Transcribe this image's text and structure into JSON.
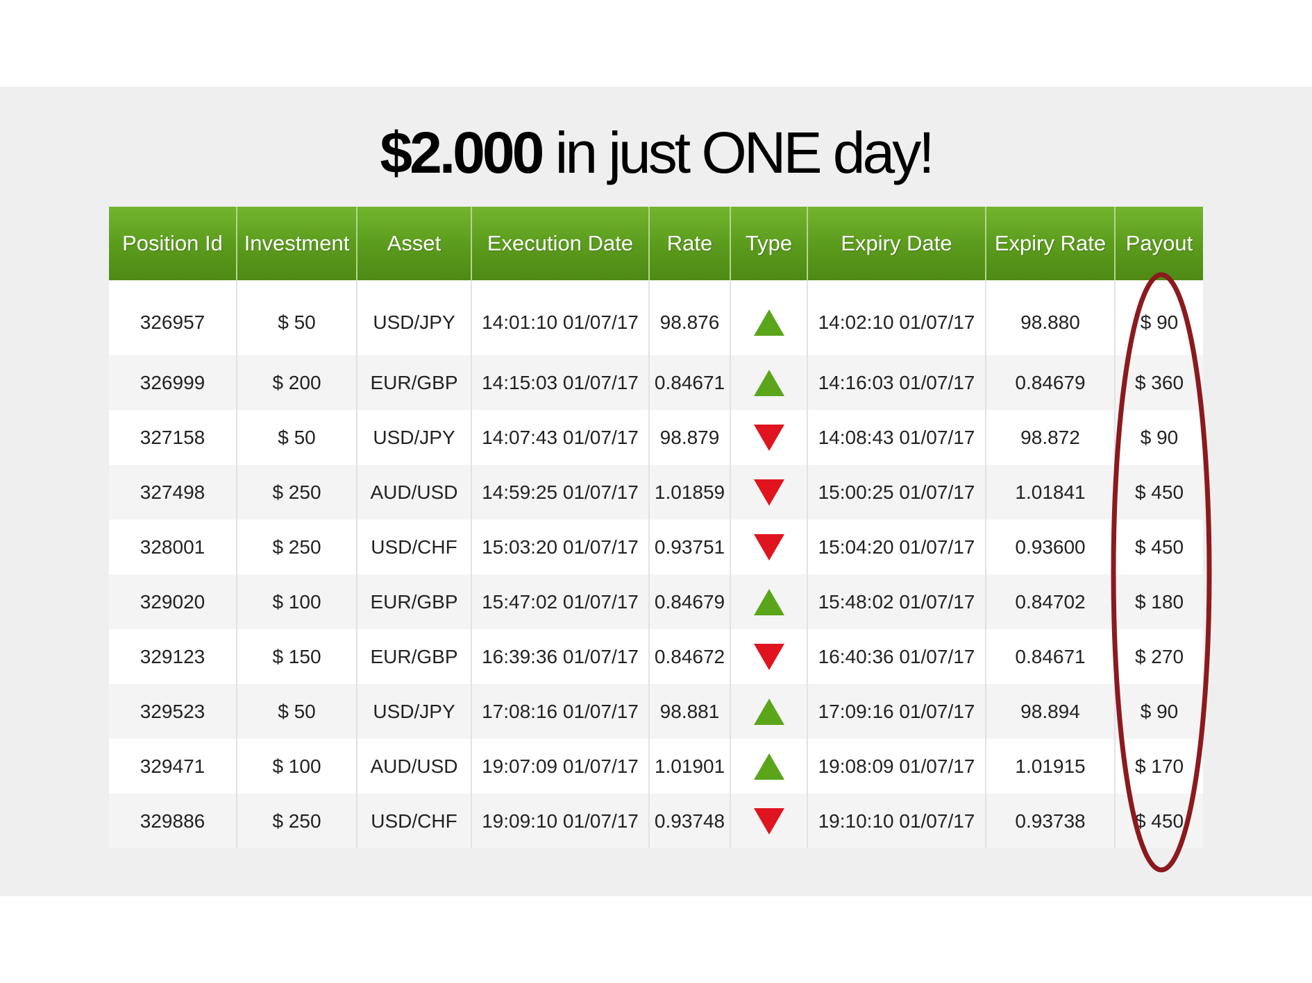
{
  "headline": {
    "amount": "$2.000",
    "rest": " in just ONE day!"
  },
  "table": {
    "headers": [
      "Position Id",
      "Investment",
      "Asset",
      "Execution Date",
      "Rate",
      "Type",
      "Expiry Date",
      "Expiry Rate",
      "Payout"
    ],
    "rows": [
      {
        "position_id": "326957",
        "investment": "$ 50",
        "asset": "USD/JPY",
        "execution_date": "14:01:10 01/07/17",
        "rate": "98.876",
        "type": "up",
        "expiry_date": "14:02:10 01/07/17",
        "expiry_rate": "98.880",
        "payout": "$ 90"
      },
      {
        "position_id": "326999",
        "investment": "$ 200",
        "asset": "EUR/GBP",
        "execution_date": "14:15:03 01/07/17",
        "rate": "0.84671",
        "type": "up",
        "expiry_date": "14:16:03 01/07/17",
        "expiry_rate": "0.84679",
        "payout": "$ 360"
      },
      {
        "position_id": "327158",
        "investment": "$ 50",
        "asset": "USD/JPY",
        "execution_date": "14:07:43 01/07/17",
        "rate": "98.879",
        "type": "down",
        "expiry_date": "14:08:43 01/07/17",
        "expiry_rate": "98.872",
        "payout": "$ 90"
      },
      {
        "position_id": "327498",
        "investment": "$ 250",
        "asset": "AUD/USD",
        "execution_date": "14:59:25 01/07/17",
        "rate": "1.01859",
        "type": "down",
        "expiry_date": "15:00:25 01/07/17",
        "expiry_rate": "1.01841",
        "payout": "$ 450"
      },
      {
        "position_id": "328001",
        "investment": "$ 250",
        "asset": "USD/CHF",
        "execution_date": "15:03:20 01/07/17",
        "rate": "0.93751",
        "type": "down",
        "expiry_date": "15:04:20 01/07/17",
        "expiry_rate": "0.93600",
        "payout": "$ 450"
      },
      {
        "position_id": "329020",
        "investment": "$ 100",
        "asset": "EUR/GBP",
        "execution_date": "15:47:02 01/07/17",
        "rate": "0.84679",
        "type": "up",
        "expiry_date": "15:48:02 01/07/17",
        "expiry_rate": "0.84702",
        "payout": "$ 180"
      },
      {
        "position_id": "329123",
        "investment": "$ 150",
        "asset": "EUR/GBP",
        "execution_date": "16:39:36 01/07/17",
        "rate": "0.84672",
        "type": "down",
        "expiry_date": "16:40:36 01/07/17",
        "expiry_rate": "0.84671",
        "payout": "$ 270"
      },
      {
        "position_id": "329523",
        "investment": "$ 50",
        "asset": "USD/JPY",
        "execution_date": "17:08:16 01/07/17",
        "rate": "98.881",
        "type": "up",
        "expiry_date": "17:09:16 01/07/17",
        "expiry_rate": "98.894",
        "payout": "$ 90"
      },
      {
        "position_id": "329471",
        "investment": "$ 100",
        "asset": "AUD/USD",
        "execution_date": "19:07:09 01/07/17",
        "rate": "1.01901",
        "type": "up",
        "expiry_date": "19:08:09 01/07/17",
        "expiry_rate": "1.01915",
        "payout": "$ 170"
      },
      {
        "position_id": "329886",
        "investment": "$ 250",
        "asset": "USD/CHF",
        "execution_date": "19:09:10 01/07/17",
        "rate": "0.93748",
        "type": "down",
        "expiry_date": "19:10:10 01/07/17",
        "expiry_rate": "0.93738",
        "payout": "$ 450"
      }
    ]
  },
  "icons": {
    "up": "green-up-triangle-icon",
    "down": "red-down-triangle-icon"
  },
  "colors": {
    "header_green": "#5a9a1c",
    "up_green": "#5aa51a",
    "down_red": "#e0141e",
    "highlight_oval": "#8b1a1f",
    "band_gray": "#efefef"
  }
}
